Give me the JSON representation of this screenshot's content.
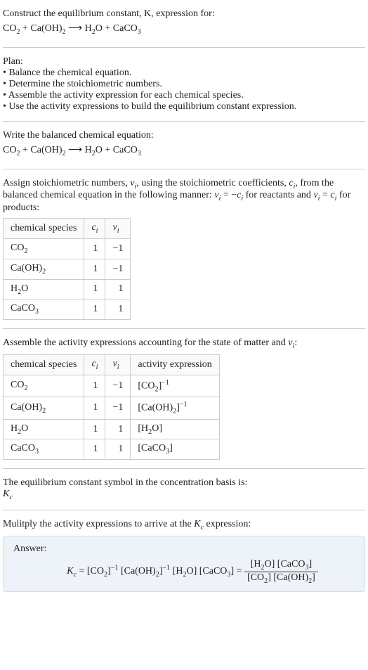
{
  "intro": {
    "prompt_line1": "Construct the equilibrium constant, K, expression for:",
    "equation_html": "CO<span class='sub'>2</span> + Ca(OH)<span class='sub'>2</span> ⟶ H<span class='sub'>2</span>O + CaCO<span class='sub'>3</span>"
  },
  "plan": {
    "label": "Plan:",
    "items": [
      "• Balance the chemical equation.",
      "• Determine the stoichiometric numbers.",
      "• Assemble the activity expression for each chemical species.",
      "• Use the activity expressions to build the equilibrium constant expression."
    ]
  },
  "balanced": {
    "label": "Write the balanced chemical equation:",
    "equation_html": "CO<span class='sub'>2</span> + Ca(OH)<span class='sub'>2</span> ⟶ H<span class='sub'>2</span>O + CaCO<span class='sub'>3</span>"
  },
  "stoich": {
    "intro_html": "Assign stoichiometric numbers, <span class='italic'>ν<span class='sub'>i</span></span>, using the stoichiometric coefficients, <span class='italic'>c<span class='sub'>i</span></span>, from the balanced chemical equation in the following manner: <span class='italic'>ν<span class='sub'>i</span></span> = −<span class='italic'>c<span class='sub'>i</span></span> for reactants and <span class='italic'>ν<span class='sub'>i</span></span> = <span class='italic'>c<span class='sub'>i</span></span> for products:",
    "headers": {
      "species": "chemical species",
      "ci_html": "<span class='italic'>c<span class='sub'>i</span></span>",
      "vi_html": "<span class='italic'>ν<span class='sub'>i</span></span>"
    },
    "rows": [
      {
        "species_html": "CO<span class='sub'>2</span>",
        "ci": "1",
        "vi": "−1"
      },
      {
        "species_html": "Ca(OH)<span class='sub'>2</span>",
        "ci": "1",
        "vi": "−1"
      },
      {
        "species_html": "H<span class='sub'>2</span>O",
        "ci": "1",
        "vi": "1"
      },
      {
        "species_html": "CaCO<span class='sub'>3</span>",
        "ci": "1",
        "vi": "1"
      }
    ]
  },
  "activity": {
    "intro_html": "Assemble the activity expressions accounting for the state of matter and <span class='italic'>ν<span class='sub'>i</span></span>:",
    "headers": {
      "species": "chemical species",
      "ci_html": "<span class='italic'>c<span class='sub'>i</span></span>",
      "vi_html": "<span class='italic'>ν<span class='sub'>i</span></span>",
      "act": "activity expression"
    },
    "rows": [
      {
        "species_html": "CO<span class='sub'>2</span>",
        "ci": "1",
        "vi": "−1",
        "act_html": "[CO<span class='sub'>2</span>]<span class='sup'>−1</span>"
      },
      {
        "species_html": "Ca(OH)<span class='sub'>2</span>",
        "ci": "1",
        "vi": "−1",
        "act_html": "[Ca(OH)<span class='sub'>2</span>]<span class='sup'>−1</span>"
      },
      {
        "species_html": "H<span class='sub'>2</span>O",
        "ci": "1",
        "vi": "1",
        "act_html": "[H<span class='sub'>2</span>O]"
      },
      {
        "species_html": "CaCO<span class='sub'>3</span>",
        "ci": "1",
        "vi": "1",
        "act_html": "[CaCO<span class='sub'>3</span>]"
      }
    ]
  },
  "kc_symbol": {
    "label": "The equilibrium constant symbol in the concentration basis is:",
    "symbol_html": "<span class='italic'>K<span class='sub'>c</span></span>"
  },
  "multiply": {
    "label_html": "Mulitply the activity expressions to arrive at the <span class='italic'>K<span class='sub'>c</span></span> expression:"
  },
  "answer": {
    "label": "Answer:",
    "lhs_html": "<span class='italic'>K<span class='sub'>c</span></span> = [CO<span class='sub'>2</span>]<span class='sup'>−1</span> [Ca(OH)<span class='sub'>2</span>]<span class='sup'>−1</span> [H<span class='sub'>2</span>O] [CaCO<span class='sub'>3</span>] = ",
    "numer_html": "[H<span class='sub'>2</span>O] [CaCO<span class='sub'>3</span>]",
    "denom_html": "[CO<span class='sub'>2</span>] [Ca(OH)<span class='sub'>2</span>]"
  }
}
